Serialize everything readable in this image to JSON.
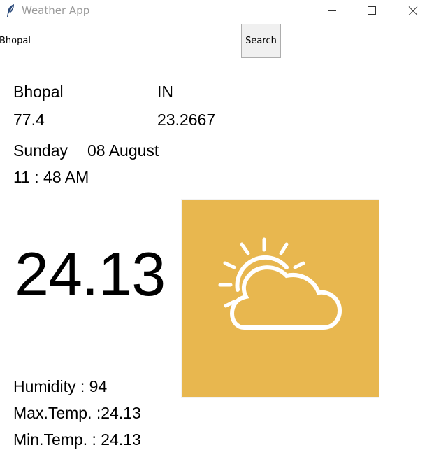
{
  "window": {
    "title": "Weather App",
    "icon": "feather-icon"
  },
  "search": {
    "value": "Bhopal",
    "placeholder": "",
    "button_label": "Search"
  },
  "location": {
    "city": "Bhopal",
    "country": "IN",
    "longitude": "77.4",
    "latitude": "23.2667"
  },
  "datetime": {
    "day": "Sunday",
    "date": "08 August",
    "time": "11 : 48 AM"
  },
  "current": {
    "temperature": "24.13",
    "condition_icon": "partly-cloudy-icon",
    "tile_color": "#e8b74f"
  },
  "stats": {
    "humidity": "Humidity : 94",
    "max_temp": "Max.Temp. :24.13",
    "min_temp": "Min.Temp. :  24.13"
  }
}
